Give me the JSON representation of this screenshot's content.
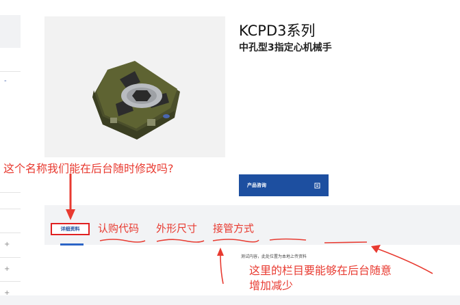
{
  "product": {
    "title": "KCPD3系列",
    "subtitle": "中孔型3指定心机械手"
  },
  "consult_button": {
    "label": "产品咨询"
  },
  "tabs": {
    "active_label": "详细资料",
    "extra": [
      "认购代码",
      "外形尺寸",
      "接管方式"
    ]
  },
  "content": {
    "test_text": "测试内容，此处位置为本地上传资料"
  },
  "annotations": {
    "question": "这个名称我们能在后台随时修改吗?",
    "note_line1": "这里的栏目要能够在后台随意",
    "note_line2": "增加减少",
    "color": "#e83a30"
  },
  "sidebar": {
    "expand_symbol": "+",
    "collapse_symbol": "-"
  },
  "colors": {
    "primary": "#1d4fa0",
    "annotation": "#e83a30"
  }
}
